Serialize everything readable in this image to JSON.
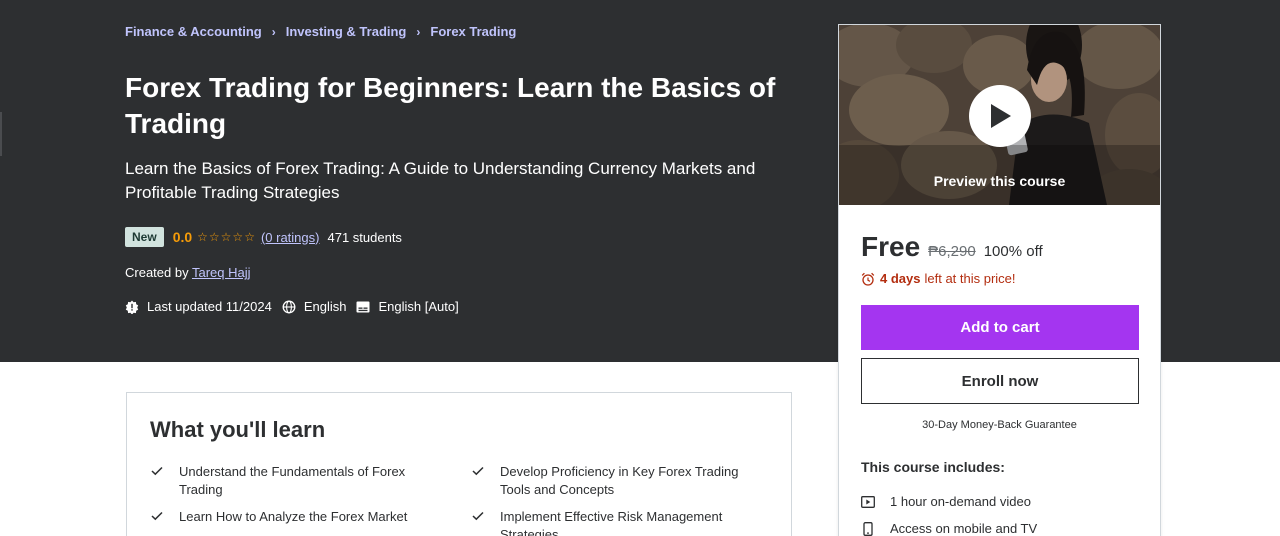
{
  "breadcrumb": [
    {
      "label": "Finance & Accounting"
    },
    {
      "label": "Investing & Trading"
    },
    {
      "label": "Forex Trading"
    }
  ],
  "course": {
    "title": "Forex Trading for Beginners: Learn the Basics of Trading",
    "subtitle": "Learn the Basics of Forex Trading: A Guide to Understanding Currency Markets and Profitable Trading Strategies",
    "badge": "New",
    "rating_value": "0.0",
    "rating_stars": 0,
    "ratings_link": "(0 ratings)",
    "students": "471 students",
    "created_by_label": "Created by",
    "instructor": "Tareq Hajj",
    "last_updated": "Last updated 11/2024",
    "language": "English",
    "captions": "English [Auto]"
  },
  "card": {
    "preview_label": "Preview this course",
    "price_current": "Free",
    "price_original": "₱6,290",
    "price_discount": "100% off",
    "deadline_bold": "4 days",
    "deadline_rest": "left at this price!",
    "add_to_cart": "Add to cart",
    "enroll_now": "Enroll now",
    "guarantee": "30-Day Money-Back Guarantee",
    "includes_heading": "This course includes:",
    "includes": [
      {
        "icon": "video-icon",
        "label": "1 hour on-demand video"
      },
      {
        "icon": "mobile-icon",
        "label": "Access on mobile and TV"
      }
    ]
  },
  "learn": {
    "title": "What you'll learn",
    "items": [
      "Understand the Fundamentals of Forex Trading",
      "Develop Proficiency in Key Forex Trading Tools and Concepts",
      "Learn How to Analyze the Forex Market",
      "Implement Effective Risk Management Strategies"
    ]
  },
  "colors": {
    "hero_bg": "#2d2f31",
    "link": "#c0c4fc",
    "star": "#f69c08",
    "accent": "#a435f0",
    "deadline": "#b32d0f"
  }
}
